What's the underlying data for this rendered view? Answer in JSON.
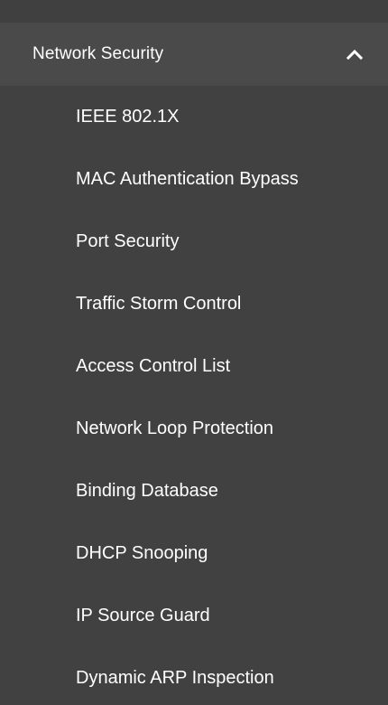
{
  "sidebar": {
    "group": {
      "label": "Network Security",
      "expanded": true,
      "icon": "chevron-up-icon"
    },
    "items": [
      {
        "label": "IEEE 802.1X"
      },
      {
        "label": "MAC Authentication Bypass"
      },
      {
        "label": "Port Security"
      },
      {
        "label": "Traffic Storm Control"
      },
      {
        "label": "Access Control List"
      },
      {
        "label": "Network Loop Protection"
      },
      {
        "label": "Binding Database"
      },
      {
        "label": "DHCP Snooping"
      },
      {
        "label": "IP Source Guard"
      },
      {
        "label": "Dynamic ARP Inspection"
      }
    ]
  },
  "colors": {
    "background": "#414141",
    "header_background": "#4a4a4a",
    "text": "#ffffff"
  }
}
